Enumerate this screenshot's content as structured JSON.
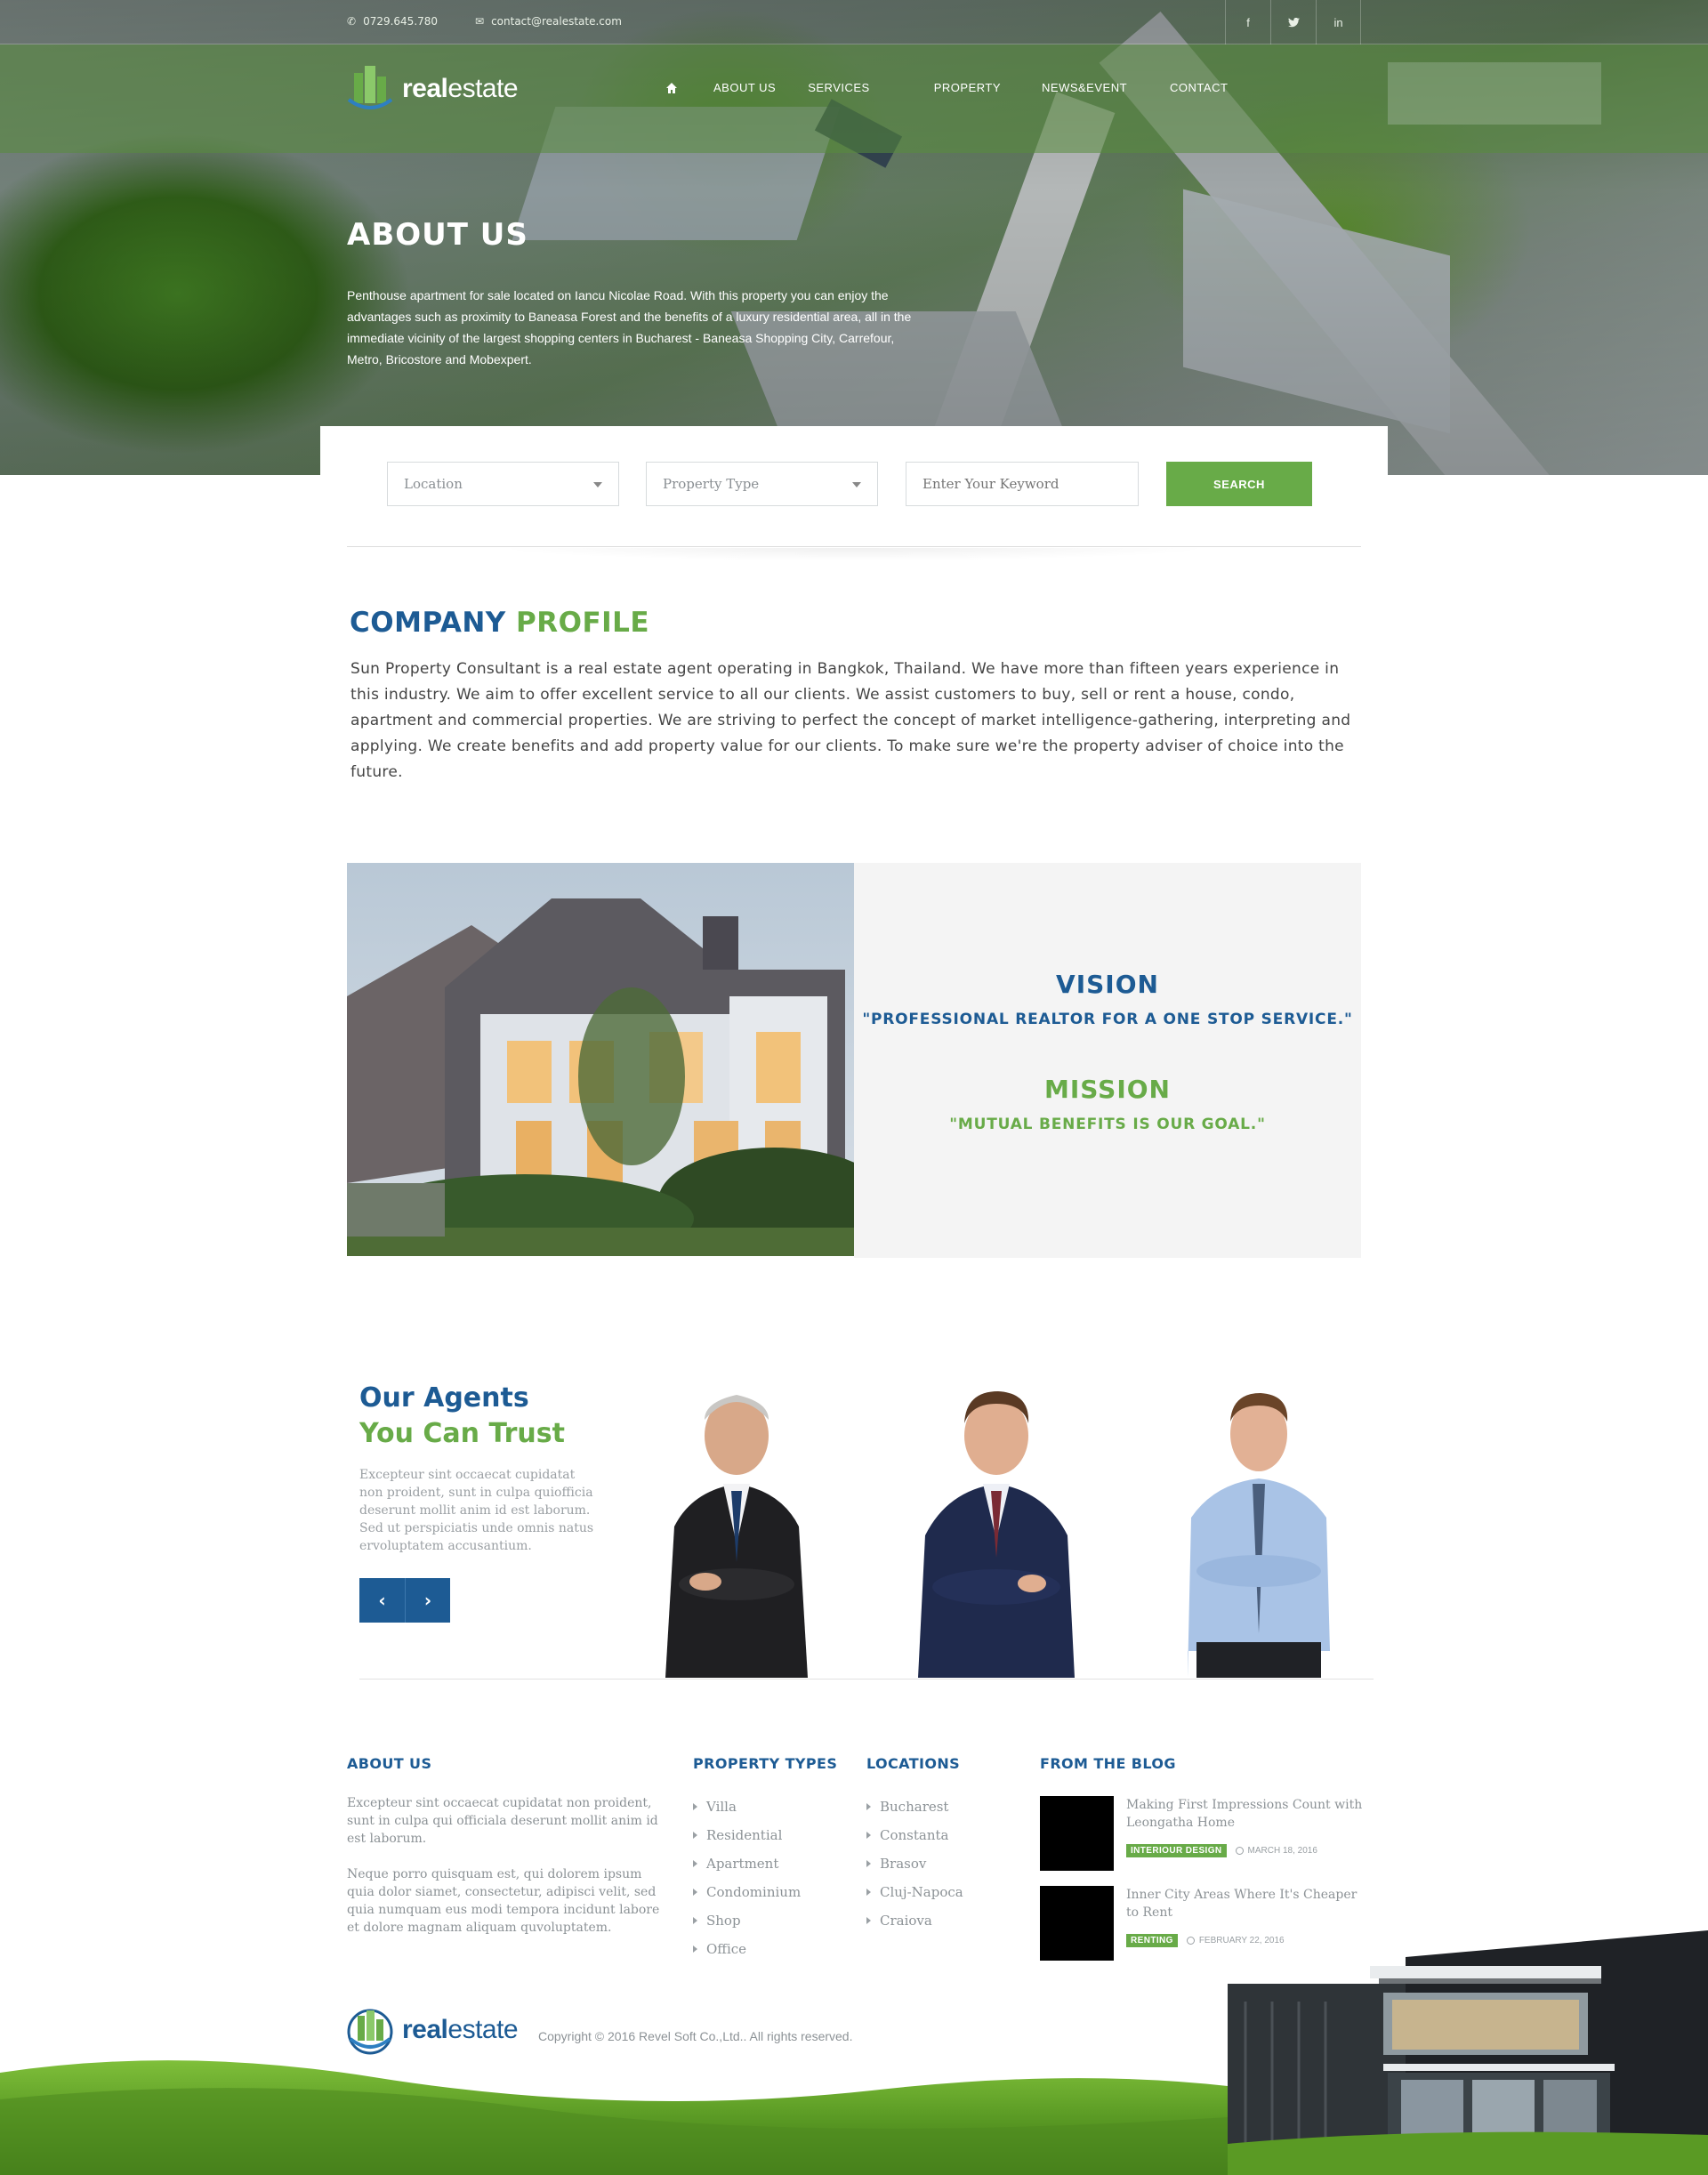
{
  "topbar": {
    "phone": "0729.645.780",
    "email": "contact@realestate.com",
    "socials": [
      "f",
      "t",
      "in"
    ]
  },
  "logo": {
    "bold": "real",
    "light": "estate"
  },
  "nav": {
    "home_icon": "home-icon",
    "items": [
      "ABOUT US",
      "SERVICES",
      "PROPERTY",
      "NEWS&EVENT",
      "CONTACT"
    ]
  },
  "hero": {
    "title": "ABOUT US",
    "text": "Penthouse apartment for sale located on Iancu Nicolae Road. With this property you can enjoy the advantages such as proximity to Baneasa Forest and the benefits of a luxury residential area, all in the immediate vicinity of the largest shopping centers in Bucharest - Baneasa Shopping City, Carrefour, Metro, Bricostore and Mobexpert."
  },
  "search": {
    "location": "Location",
    "property_type": "Property Type",
    "keyword_placeholder": "Enter Your Keyword",
    "button": "SEARCH"
  },
  "profile": {
    "title_blue": "COMPANY",
    "title_green": "PROFILE",
    "text": "Sun Property Consultant is a real estate agent operating in Bangkok, Thailand. We have more than fifteen years experience in this industry. We aim to offer excellent service to all our clients. We assist customers to buy, sell or rent a house, condo, apartment and commercial properties. We are striving to perfect the concept of market intelligence-gathering, interpreting and applying. We create benefits and add property value for our clients. To make sure we're the property adviser of choice into the future."
  },
  "vision": {
    "heading": "VISION",
    "text": "\"PROFESSIONAL REALTOR FOR A ONE STOP SERVICE.\""
  },
  "mission": {
    "heading": "MISSION",
    "text": "\"MUTUAL BENEFITS IS OUR GOAL.\""
  },
  "agents": {
    "title_line1": "Our Agents",
    "title_line2": "You Can Trust",
    "text": "Excepteur sint occaecat cupidatat non proident, sunt in culpa quiofficia deserunt mollit anim id est laborum. Sed ut perspiciatis unde omnis natus ervoluptatem accusantium.",
    "prev": "‹",
    "next": "›"
  },
  "footer": {
    "about": {
      "heading": "ABOUT US",
      "p1": "Excepteur sint occaecat cupidatat non proident, sunt in culpa qui officiala deserunt mollit anim id est laborum.",
      "p2": "Neque porro quisquam est, qui dolorem ipsum quia dolor siamet, consectetur, adipisci velit, sed quia numquam eus modi tempora incidunt labore et dolore magnam aliquam quvoluptatem."
    },
    "types": {
      "heading": "PROPERTY TYPES",
      "items": [
        "Villa",
        "Residential",
        "Apartment",
        "Condominium",
        "Shop",
        "Office"
      ]
    },
    "locations": {
      "heading": "LOCATIONS",
      "items": [
        "Bucharest",
        "Constanta",
        "Brasov",
        "Cluj-Napoca",
        "Craiova"
      ]
    },
    "blog": {
      "heading": "FROM THE BLOG",
      "posts": [
        {
          "title": "Making First Impressions Count with Leongatha Home",
          "tag": "INTERIOUR DESIGN",
          "date": "MARCH 18, 2016"
        },
        {
          "title": "Inner City Areas Where It's Cheaper to Rent",
          "tag": "RENTING",
          "date": "FEBRUARY 22, 2016"
        }
      ]
    },
    "copyright": "Copyright © 2016 Revel Soft Co.,Ltd.. All rights reserved."
  },
  "colors": {
    "brand_blue": "#1d5b94",
    "brand_green": "#68ab48"
  }
}
